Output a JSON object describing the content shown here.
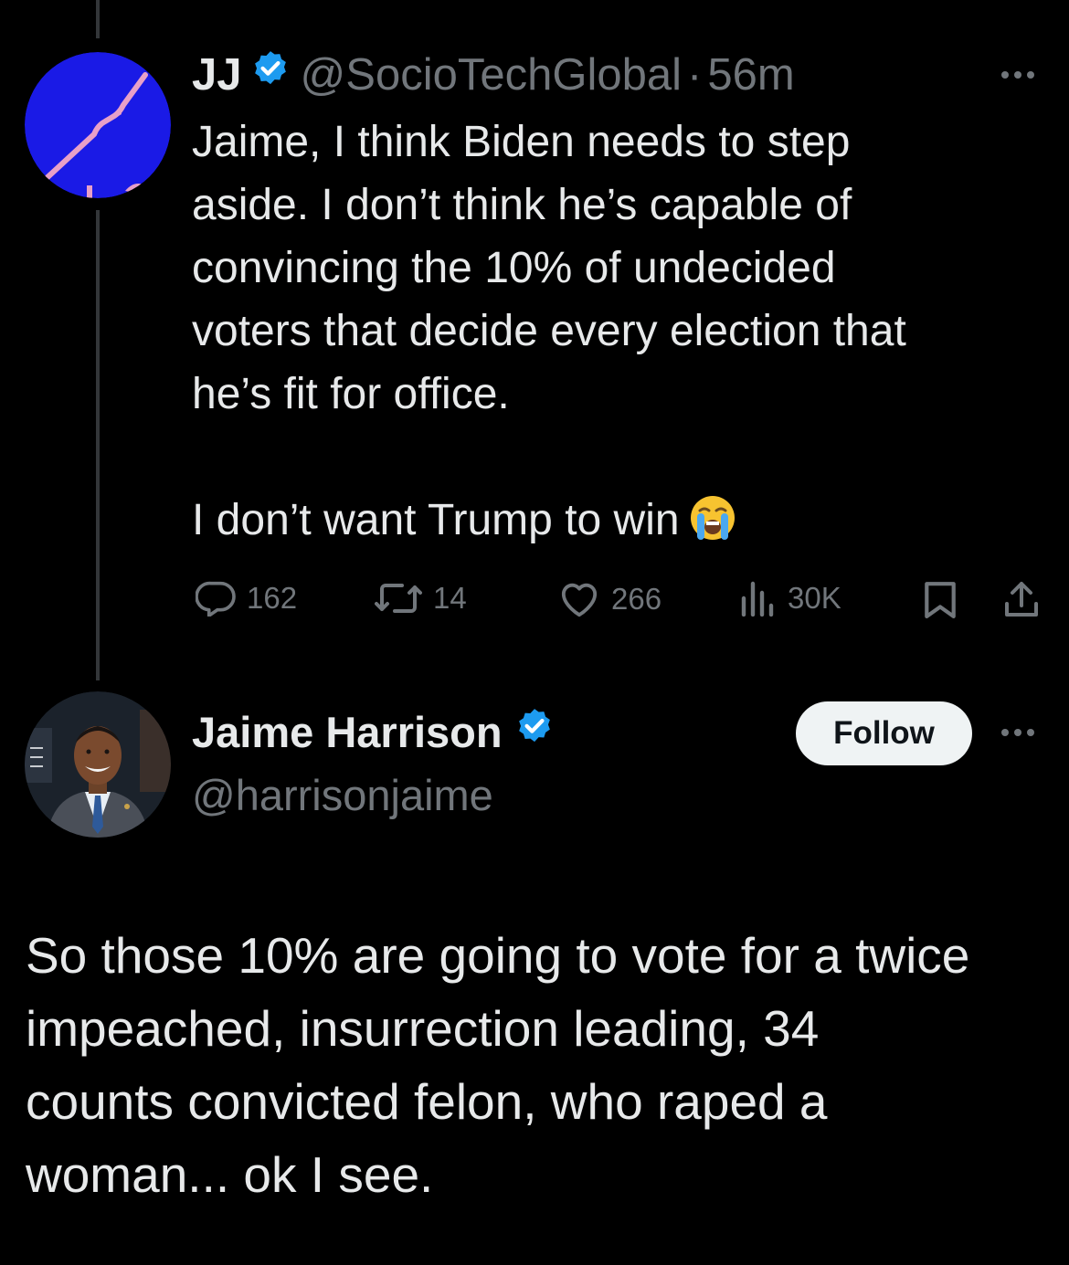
{
  "parent_tweet": {
    "author_name": "JJ",
    "handle": "@SocioTechGlobal",
    "separator": "·",
    "timestamp": "56m",
    "text_lines": [
      "Jaime, I think Biden needs to step",
      "aside. I don’t think he’s capable of",
      "convincing the 10% of undecided",
      "voters that decide every election that",
      "he’s fit for office."
    ],
    "text_2": "I don’t want Trump to win",
    "emoji": "loudly-crying-face",
    "stats": {
      "replies": "162",
      "reposts": "14",
      "likes": "266",
      "views": "30K"
    }
  },
  "main_tweet": {
    "author_name": "Jaime Harrison",
    "handle": "@harrisonjaime",
    "follow_label": "Follow",
    "text_lines": [
      "So those 10% are going to vote for a twice",
      "impeached, insurrection leading, 34",
      "counts convicted felon, who raped a",
      "woman... ok I see."
    ]
  },
  "colors": {
    "background": "#000000",
    "text": "#e7e9ea",
    "muted": "#71767b",
    "verified": "#1d9bf0",
    "avatar_blue": "#1a1ae6",
    "avatar_pink": "#e8a0c8"
  }
}
